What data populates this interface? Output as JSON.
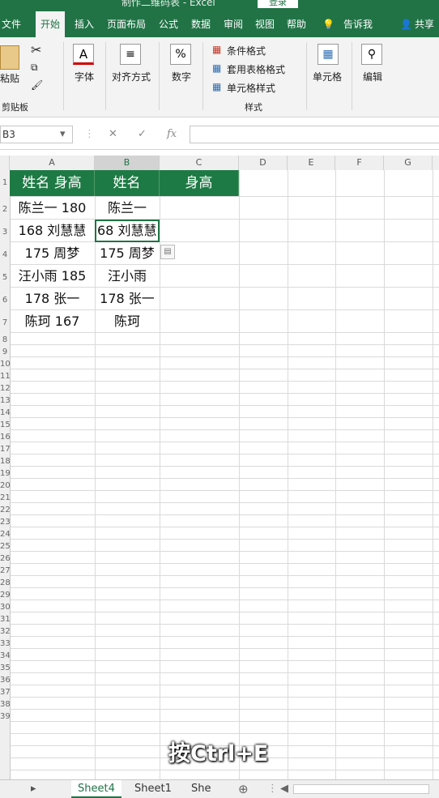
{
  "titlebar": {
    "title": "制作二维码表 - Excel",
    "login": "登录"
  },
  "ribbon_tabs": [
    "文件",
    "开始",
    "插入",
    "页面布局",
    "公式",
    "数据",
    "审阅",
    "视图",
    "帮助",
    "告诉我",
    "共享"
  ],
  "ribbon": {
    "paste": "粘贴",
    "clipboard": "剪贴板",
    "font": "字体",
    "align": "对齐方式",
    "number": "数字",
    "cond_format": "条件格式",
    "table_format": "套用表格格式",
    "cell_style": "单元格样式",
    "styles_group": "样式",
    "cells": "单元格",
    "edit": "编辑"
  },
  "formula_bar": {
    "name_box": "B3",
    "fx": "fx",
    "value": ""
  },
  "columns": [
    "A",
    "B",
    "C",
    "D",
    "E",
    "F",
    "G"
  ],
  "rows": [
    "1",
    "2",
    "3",
    "4",
    "5",
    "6",
    "7",
    "8",
    "9",
    "10",
    "11",
    "12",
    "13",
    "14",
    "15",
    "16",
    "17",
    "18",
    "19",
    "20",
    "21",
    "22",
    "23",
    "24",
    "25",
    "26",
    "27",
    "28",
    "29",
    "30",
    "31",
    "32",
    "33",
    "34",
    "35",
    "36",
    "37",
    "38",
    "39"
  ],
  "sheet": {
    "header": [
      "姓名 身高",
      "姓名",
      "身高"
    ],
    "col_a": [
      "陈兰一 180",
      "168 刘慧慧",
      "175 周梦",
      "汪小雨 185",
      "178 张一",
      "陈珂 167"
    ],
    "col_b": [
      "陈兰一",
      "68 刘慧慧",
      "175 周梦",
      "汪小雨",
      "178 张一",
      "陈珂"
    ]
  },
  "subtitle": "按Ctrl+E",
  "sheet_tabs": [
    "Sheet4",
    "Sheet1",
    "She"
  ],
  "colors": {
    "accent": "#217346",
    "header_fill": "#1e7a44"
  }
}
